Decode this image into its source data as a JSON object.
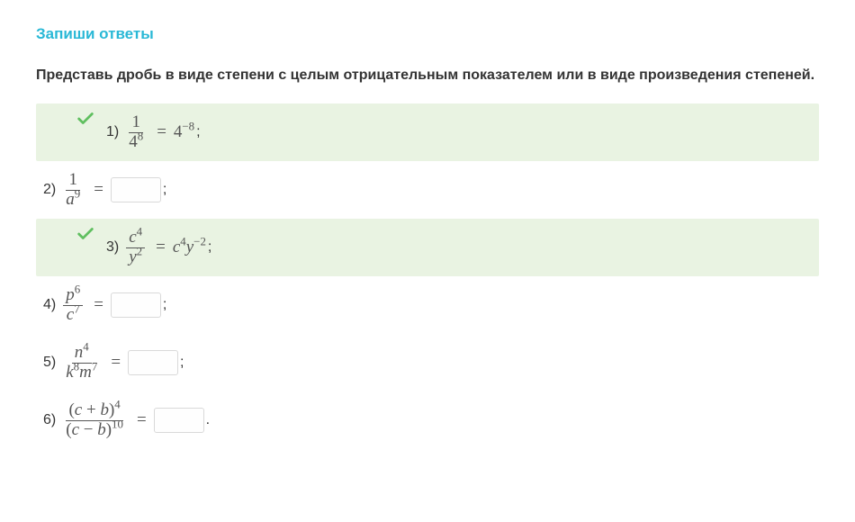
{
  "title": "Запиши ответы",
  "instruction": "Представь дробь в виде степени с целым отрицательным показателем или в виде произведения степеней.",
  "items": [
    {
      "label": "1)",
      "frac_top": "1",
      "frac_bot_html": "4<sup>8</sup>",
      "rhs_html": "4<sup>−8</sup>",
      "correct": true,
      "trailing": ";"
    },
    {
      "label": "2)",
      "frac_top": "1",
      "frac_bot_html": "<span class='it'>a</span><sup>9</sup>",
      "input": true,
      "correct": false,
      "trailing": ";"
    },
    {
      "label": "3)",
      "frac_top_html": "<span class='it'>c</span><sup>4</sup>",
      "frac_bot_html": "<span class='it'>y</span><sup>2</sup>",
      "rhs_html": "<span class='it'>c</span><sup>4</sup><span class='it'>y</span><sup>−2</sup>",
      "correct": true,
      "trailing": ";"
    },
    {
      "label": "4)",
      "frac_top_html": "<span class='it'>p</span><sup>6</sup>",
      "frac_bot_html": "<span class='it'>c</span><sup>7</sup>",
      "input": true,
      "correct": false,
      "trailing": ";"
    },
    {
      "label": "5)",
      "frac_top_html": "<span class='it'>n</span><sup>4</sup>",
      "frac_bot_html": "<span class='it'>k</span><sup>8</sup><span class='it'>m</span><sup>7</sup>",
      "input": true,
      "correct": false,
      "trailing": ";"
    },
    {
      "label": "6)",
      "frac_top_html": "(<span class='it'>c</span> + <span class='it'>b</span>)<sup>4</sup>",
      "frac_bot_html": "(<span class='it'>c</span> − <span class='it'>b</span>)<sup>10</sup>",
      "input": true,
      "correct": false,
      "trailing": "."
    }
  ]
}
